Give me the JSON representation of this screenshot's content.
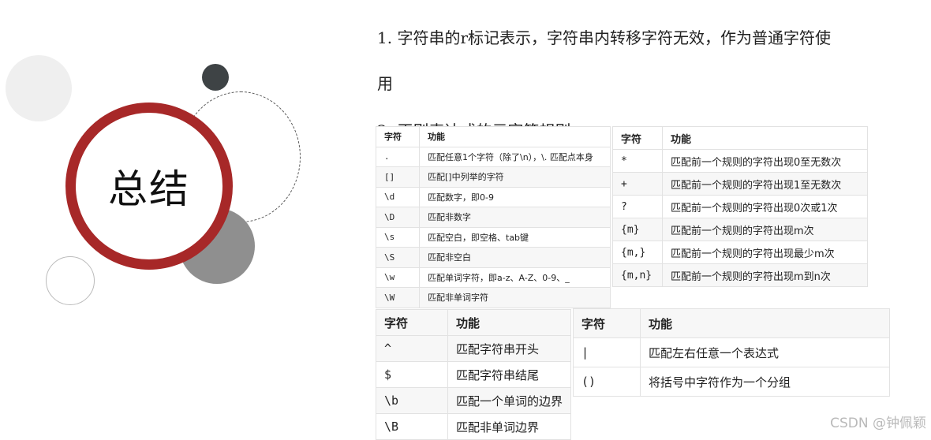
{
  "slide": {
    "title": "总结",
    "point1_line1": "1. 字符串的r标记表示，字符串内转移字符无效，作为普通字符使",
    "point1_line2": "用",
    "point2": "2. 正则表达式的元字符规则"
  },
  "table_basic": {
    "headers": [
      "字符",
      "功能"
    ],
    "rows": [
      [
        ".",
        "匹配任意1个字符（除了\\n），\\. 匹配点本身"
      ],
      [
        "[]",
        "匹配[]中列举的字符"
      ],
      [
        "\\d",
        "匹配数字，即0-9"
      ],
      [
        "\\D",
        "匹配非数字"
      ],
      [
        "\\s",
        "匹配空白，即空格、tab键"
      ],
      [
        "\\S",
        "匹配非空白"
      ],
      [
        "\\w",
        "匹配单词字符，即a-z、A-Z、0-9、_"
      ],
      [
        "\\W",
        "匹配非单词字符"
      ]
    ]
  },
  "table_quantifier": {
    "headers": [
      "字符",
      "功能"
    ],
    "rows": [
      [
        "*",
        "匹配前一个规则的字符出现0至无数次"
      ],
      [
        "+",
        "匹配前一个规则的字符出现1至无数次"
      ],
      [
        "?",
        "匹配前一个规则的字符出现0次或1次"
      ],
      [
        "{m}",
        "匹配前一个规则的字符出现m次"
      ],
      [
        "{m,}",
        "匹配前一个规则的字符出现最少m次"
      ],
      [
        "{m,n}",
        "匹配前一个规则的字符出现m到n次"
      ]
    ]
  },
  "table_boundary": {
    "headers": [
      "字符",
      "功能"
    ],
    "rows": [
      [
        "^",
        "匹配字符串开头"
      ],
      [
        "$",
        "匹配字符串结尾"
      ],
      [
        "\\b",
        "匹配一个单词的边界"
      ],
      [
        "\\B",
        "匹配非单词边界"
      ]
    ]
  },
  "table_group": {
    "headers": [
      "字符",
      "功能"
    ],
    "rows": [
      [
        "|",
        "匹配左右任意一个表达式"
      ],
      [
        "()",
        "将括号中字符作为一个分组"
      ]
    ]
  },
  "watermark": "CSDN @钟佩颖"
}
